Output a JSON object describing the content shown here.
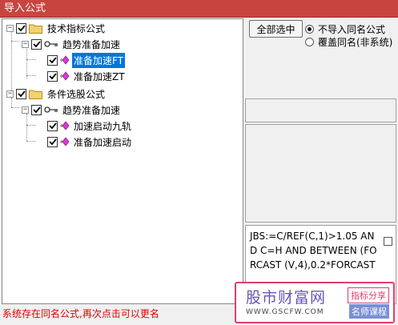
{
  "window": {
    "title": "导入公式"
  },
  "tree": {
    "nodes": [
      {
        "label": "技术指标公式",
        "checked": true,
        "expander": "−",
        "icon": "folder-icon"
      },
      {
        "label": "趋势准备加速",
        "checked": true,
        "expander": "−",
        "icon": "key-icon"
      },
      {
        "label": "准备加速FT",
        "checked": true,
        "icon": "formula-gem-icon",
        "selected": true
      },
      {
        "label": "准备加速ZT",
        "checked": true,
        "icon": "formula-gem-icon"
      },
      {
        "label": "条件选股公式",
        "checked": true,
        "expander": "−",
        "icon": "folder-icon"
      },
      {
        "label": "趋势准备加速",
        "checked": true,
        "expander": "−",
        "icon": "key-icon"
      },
      {
        "label": "加速启动九轨",
        "checked": true,
        "icon": "formula-gem-icon"
      },
      {
        "label": "准备加速启动",
        "checked": true,
        "icon": "formula-gem-icon"
      }
    ]
  },
  "controls": {
    "select_all_label": "全部选中",
    "radio_no_import": "不导入同名公式",
    "radio_overwrite": "覆盖同名(非系统)",
    "selected_radio": "no_import"
  },
  "code_preview": {
    "text": "JBS:=C/REF(C,1)>1.05 AND C=H AND BETWEEN (FORCAST (V,4),0.2*FORCAST"
  },
  "status_text": "系统存在同名公式,再次点击可以更名",
  "watermark": {
    "site_name": "股市财富网",
    "url": "WWW.GSCFW.COM",
    "tag1": "指标分享",
    "tag2": "名师课程"
  },
  "colors": {
    "titlebar": "#c8443f",
    "selection": "#0078d7",
    "status_red": "#e00000",
    "gem_magenta": "#d63bd1"
  }
}
